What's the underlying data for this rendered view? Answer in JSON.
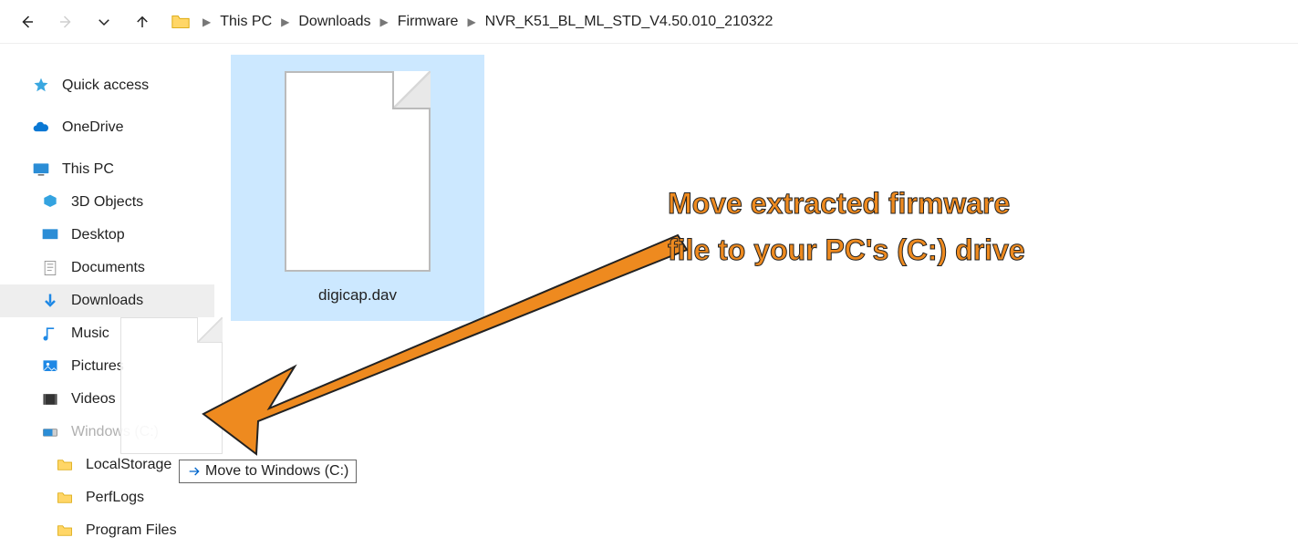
{
  "breadcrumb": {
    "segments": [
      "This PC",
      "Downloads",
      "Firmware",
      "NVR_K51_BL_ML_STD_V4.50.010_210322"
    ]
  },
  "sidebar": {
    "quick_access": "Quick access",
    "onedrive": "OneDrive",
    "this_pc": "This PC",
    "items": {
      "objects3d": "3D Objects",
      "desktop": "Desktop",
      "documents": "Documents",
      "downloads": "Downloads",
      "music": "Music",
      "pictures": "Pictures",
      "videos": "Videos",
      "windows_c": "Windows (C:)",
      "localstorage": "LocalStorage",
      "perflogs": "PerfLogs",
      "program_files": "Program Files"
    }
  },
  "file": {
    "name": "digicap.dav"
  },
  "tooltip": {
    "text": "Move to Windows (C:)"
  },
  "annotation": {
    "line1": "Move extracted firmware",
    "line2": "file to your PC's (C:) drive"
  }
}
